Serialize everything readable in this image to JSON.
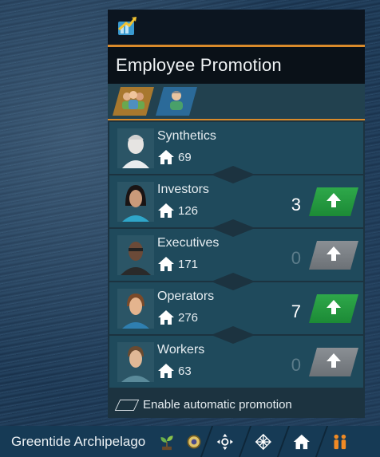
{
  "panel": {
    "title": "Employee Promotion",
    "header_icon": "promotion-chart-icon",
    "tabs": [
      {
        "name": "group-promotion-tab",
        "icon": "workers-group-icon",
        "active": true
      },
      {
        "name": "single-promotion-tab",
        "icon": "single-worker-icon",
        "active": false
      }
    ],
    "populations": [
      {
        "name": "Synthetics",
        "count": "69",
        "promote": null,
        "enabled": false
      },
      {
        "name": "Investors",
        "count": "126",
        "promote": "3",
        "enabled": true
      },
      {
        "name": "Executives",
        "count": "171",
        "promote": "0",
        "enabled": false
      },
      {
        "name": "Operators",
        "count": "276",
        "promote": "7",
        "enabled": true
      },
      {
        "name": "Workers",
        "count": "63",
        "promote": "0",
        "enabled": false
      }
    ],
    "auto_promotion_label": "Enable automatic promotion",
    "colors": {
      "accent": "#d98a2b",
      "enabled_button": "#2ea84a",
      "disabled_button": "#7c8186"
    }
  },
  "bottom_bar": {
    "region_name": "Greentide Archipelago",
    "icons": [
      "sprout-icon",
      "gear-icon",
      "move-icon",
      "grid-icon",
      "home-icon",
      "population-icon"
    ]
  }
}
